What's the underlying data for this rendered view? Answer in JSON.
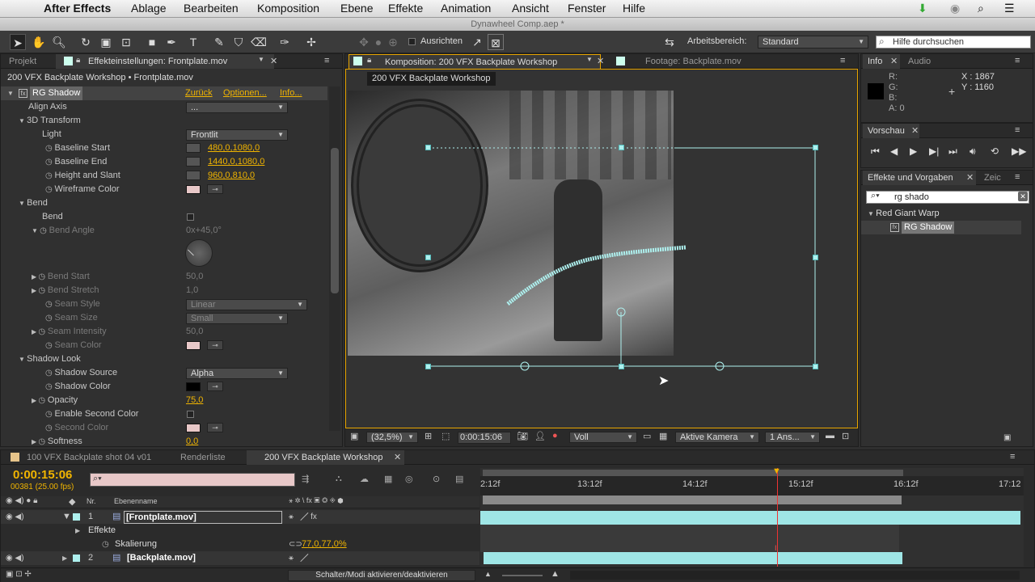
{
  "menubar": {
    "apple": "",
    "app": "After Effects",
    "items": [
      "Ablage",
      "Bearbeiten",
      "Komposition",
      "Ebene",
      "Effekte",
      "Animation",
      "Ansicht",
      "Fenster",
      "Hilfe"
    ]
  },
  "window_title": "Dynawheel Comp.aep *",
  "toolbar": {
    "ausrichten": "Ausrichten",
    "arbeitsbereich_label": "Arbeitsbereich:",
    "arbeitsbereich_value": "Standard",
    "help_placeholder": "Hilfe durchsuchen"
  },
  "left_panel": {
    "tab_projekt": "Projekt",
    "tab_effects": "Effekteinstellungen: Frontplate.mov",
    "header": "200 VFX Backplate Workshop • Frontplate.mov",
    "effect_name": "RG Shadow",
    "zuruck": "Zurück",
    "optionen": "Optionen...",
    "info": "Info...",
    "rows": {
      "align_axis": "Align Axis",
      "align_axis_val": "...",
      "transform_3d": "3D Transform",
      "light": "Light",
      "light_val": "Frontlit",
      "baseline_start": "Baseline Start",
      "baseline_start_val": "480,0,1080,0",
      "baseline_end": "Baseline End",
      "baseline_end_val": "1440,0,1080,0",
      "height_slant": "Height and Slant",
      "height_slant_val": "960,0,810,0",
      "wireframe_color": "Wireframe Color",
      "bend_group": "Bend",
      "bend": "Bend",
      "bend_angle": "Bend Angle",
      "bend_angle_val": "0x+45,0°",
      "bend_start": "Bend Start",
      "bend_start_val": "50,0",
      "bend_stretch": "Bend Stretch",
      "bend_stretch_val": "1,0",
      "seam_style": "Seam Style",
      "seam_style_val": "Linear",
      "seam_size": "Seam Size",
      "seam_size_val": "Small",
      "seam_intensity": "Seam Intensity",
      "seam_intensity_val": "50,0",
      "seam_color": "Seam Color",
      "shadow_look": "Shadow Look",
      "shadow_source": "Shadow Source",
      "shadow_source_val": "Alpha",
      "shadow_color": "Shadow Color",
      "opacity": "Opacity",
      "opacity_val": "75,0",
      "enable_second": "Enable Second Color",
      "second_color": "Second Color",
      "softness": "Softness",
      "softness_val": "0,0"
    }
  },
  "comp_panel": {
    "tab_comp": "Komposition: 200 VFX Backplate Workshop",
    "tab_footage": "Footage: Backplate.mov",
    "comp_label": "200 VFX Backplate Workshop",
    "zoom": "(32,5%)",
    "timecode": "0:00:15:06",
    "resolution": "Voll",
    "camera": "Aktive Kamera",
    "views": "1 Ans..."
  },
  "info_panel": {
    "tab_info": "Info",
    "tab_audio": "Audio",
    "r": "R:",
    "g": "G:",
    "b": "B:",
    "a": "A:",
    "a_val": "0",
    "x": "X : 1867",
    "y": "Y : 1160"
  },
  "preview_panel": {
    "tab": "Vorschau"
  },
  "effects_presets": {
    "tab": "Effekte und Vorgaben",
    "tab2": "Zeic",
    "search": "rg shado",
    "group": "Red Giant Warp",
    "item": "RG Shadow"
  },
  "timeline": {
    "tab1": "100 VFX Backplate shot 04 v01",
    "tab2": "Renderliste",
    "tab3": "200 VFX Backplate Workshop",
    "timecode": "0:00:15:06",
    "frames": "00381 (25.00 fps)",
    "col_nr": "Nr.",
    "col_name": "Ebenenname",
    "ruler": [
      "2:12f",
      "13:12f",
      "14:12f",
      "15:12f",
      "16:12f",
      "17:12"
    ],
    "layers": [
      {
        "nr": "1",
        "name": "[Frontplate.mov]"
      },
      {
        "nr": "2",
        "name": "[Backplate.mov]"
      }
    ],
    "effekte": "Effekte",
    "skalierung": "Skalierung",
    "skalierung_val": "77,0,77,0%",
    "toggle": "Schalter/Modi aktivieren/deaktivieren"
  },
  "colors": {
    "accent": "#f0b400",
    "selection": "#9fe6e6"
  }
}
